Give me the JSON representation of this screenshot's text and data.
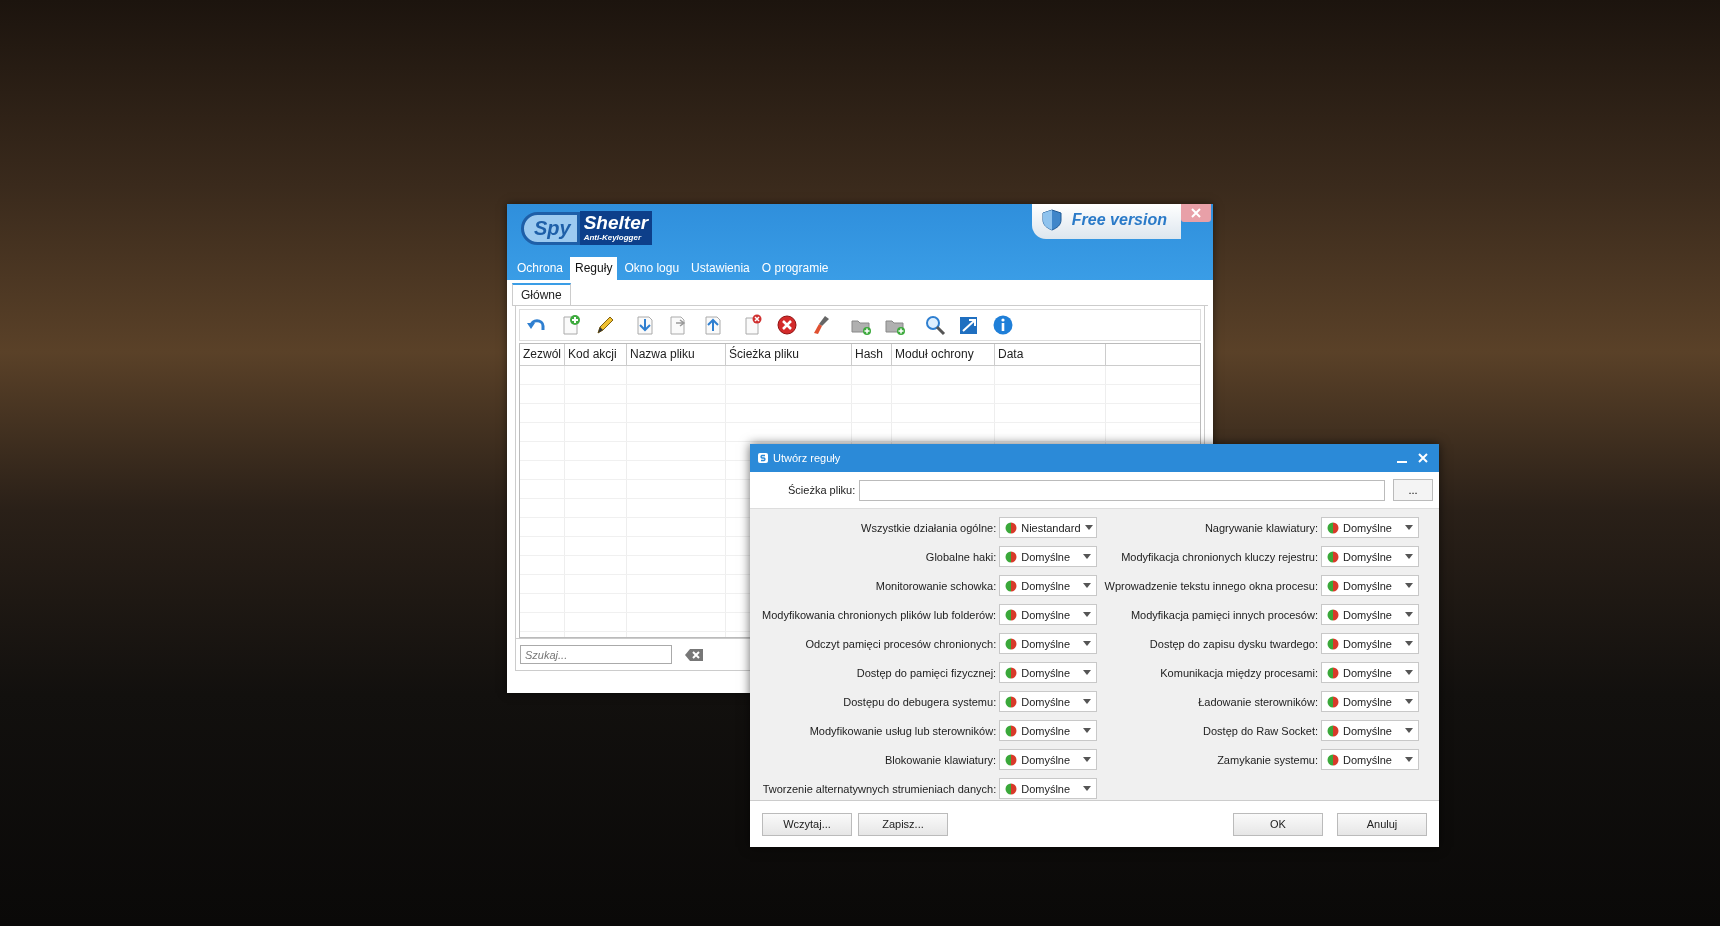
{
  "main_window": {
    "logo": {
      "mark": "Spy",
      "name": "Shelter",
      "tagline": "Anti-Keylogger"
    },
    "edition_badge": "Free version",
    "tabs": [
      {
        "label": "Ochrona",
        "selected": false
      },
      {
        "label": "Reguły",
        "selected": true
      },
      {
        "label": "Okno logu",
        "selected": false
      },
      {
        "label": "Ustawienia",
        "selected": false
      },
      {
        "label": "O programie",
        "selected": false
      }
    ],
    "sub_tabs": [
      {
        "label": "Główne",
        "selected": true
      }
    ],
    "table": {
      "columns": [
        "Zezwól",
        "Kod akcji",
        "Nazwa pliku",
        "Ścieżka pliku",
        "Hash",
        "Moduł ochrony",
        "Data"
      ]
    },
    "search": {
      "placeholder": "Szukaj..."
    }
  },
  "dialog": {
    "title": "Utwórz reguły",
    "path_label": "Ścieżka pliku:",
    "browse_button": "...",
    "left_settings": [
      {
        "label": "Wszystkie działania ogólne:",
        "value": "Niestandard"
      },
      {
        "label": "Globalne haki:",
        "value": "Domyślne"
      },
      {
        "label": "Monitorowanie schowka:",
        "value": "Domyślne"
      },
      {
        "label": "Modyfikowania chronionych plików lub folderów:",
        "value": "Domyślne"
      },
      {
        "label": "Odczyt pamięci procesów chronionych:",
        "value": "Domyślne"
      },
      {
        "label": "Dostęp do pamięci fizycznej:",
        "value": "Domyślne"
      },
      {
        "label": "Dostępu do debugera systemu:",
        "value": "Domyślne"
      },
      {
        "label": "Modyfikowanie usług lub sterowników:",
        "value": "Domyślne"
      },
      {
        "label": "Blokowanie klawiatury:",
        "value": "Domyślne"
      },
      {
        "label": "Tworzenie alternatywnych strumieniach danych:",
        "value": "Domyślne"
      }
    ],
    "right_settings": [
      {
        "label": "Nagrywanie klawiatury:",
        "value": "Domyślne"
      },
      {
        "label": "Modyfikacja chronionych kluczy rejestru:",
        "value": "Domyślne"
      },
      {
        "label": "Wprowadzenie tekstu innego okna procesu:",
        "value": "Domyślne"
      },
      {
        "label": "Modyfikacja pamięci innych procesów:",
        "value": "Domyślne"
      },
      {
        "label": "Dostęp do zapisu dysku twardego:",
        "value": "Domyślne"
      },
      {
        "label": "Komunikacja między procesami:",
        "value": "Domyślne"
      },
      {
        "label": "Ładowanie sterowników:",
        "value": "Domyślne"
      },
      {
        "label": "Dostęp do Raw Socket:",
        "value": "Domyślne"
      },
      {
        "label": "Zamykanie systemu:",
        "value": "Domyślne"
      }
    ],
    "left_buttons": [
      "Wczytaj...",
      "Zapisz..."
    ],
    "right_buttons": [
      "OK",
      "Anuluj"
    ]
  }
}
